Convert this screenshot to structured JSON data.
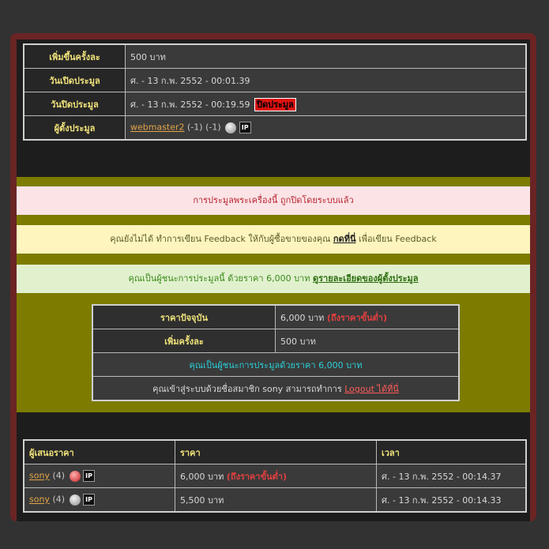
{
  "top_table": {
    "rows": [
      {
        "label": "เพิ่มขึ้นครั้งละ",
        "value": "500 บาท"
      },
      {
        "label": "วันเปิดประมูล",
        "value": "ศ. - 13 ก.พ. 2552 - 00:01.39"
      },
      {
        "label": "วันปิดประมูล",
        "value": "ศ. - 13 ก.พ. 2552 - 00:19.59",
        "badge": "ปิดประมูล"
      },
      {
        "label": "ผู้ตั้งประมูล",
        "user": "webmaster2",
        "score1": "(-1)",
        "score2": "(-1)",
        "ip_icon": "IP"
      }
    ]
  },
  "messages": {
    "closed": "การประมูลพระเครื่องนี้ ถูกปิดโดยระบบแล้ว",
    "feedback_pre": "คุณยังไม่ได้ ทำการเขียน Feedback ให้กับผู้ซื้อขายของคุณ",
    "feedback_link": "กดที่นี่",
    "feedback_post": "เพื่อเขียน Feedback",
    "winner_pre": "คุณเป็นผู้ชนะการประมูลนี้ ด้วยราคา 6,000 บาท",
    "winner_link": "ดูรายละเอียดของผู้ตั้งประมูล"
  },
  "price_table": {
    "current_label": "ราคาปัจจุบัน",
    "current_value": "6,000 บาท",
    "current_note": "(ถึงราคาขั้นต่ำ)",
    "increment_label": "เพิ่มครั้งละ",
    "increment_value": "500 บาท",
    "winner_text": "คุณเป็นผู้ชนะการประมูลด้วยราคา 6,000 บาท",
    "login_pre": "คุณเข้าสู่ระบบด้วยชื่อสมาชิก sony สามารถทำการ",
    "login_link": "Logout ได้ที่นี่"
  },
  "bids": {
    "headers": [
      "ผู้เสนอราคา",
      "ราคา",
      "เวลา"
    ],
    "rows": [
      {
        "user": "sony",
        "count": "(4)",
        "icon": "red-badge-icon",
        "ip": "IP",
        "price": "6,000 บาท",
        "note": "(ถึงราคาขั้นต่ำ)",
        "time": "ศ. - 13 ก.พ. 2552 - 00:14.37"
      },
      {
        "user": "sony",
        "count": "(4)",
        "icon": "gray-badge-icon",
        "ip": "IP",
        "price": "5,500 บาท",
        "note": "",
        "time": "ศ. - 13 ก.พ. 2552 - 00:14.33"
      }
    ]
  },
  "colors": {
    "frame": "#6b2424",
    "olive_band": "#7d7c00",
    "label_yellow": "#f0e27a",
    "link_orange": "#e3a64a",
    "alert_red": "#e04040",
    "winner_cyan": "#2bd0d8"
  }
}
